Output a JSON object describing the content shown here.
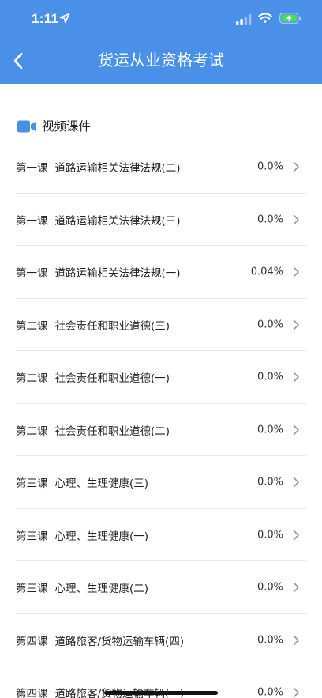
{
  "status_bar": {
    "time": "1:11"
  },
  "nav": {
    "title": "货运从业资格考试"
  },
  "section": {
    "title": "视频课件",
    "icon": "video-camera-icon"
  },
  "lessons": [
    {
      "number": "第一课",
      "name": "道路运输相关法律法规(二)",
      "progress": "0.0%"
    },
    {
      "number": "第一课",
      "name": "道路运输相关法律法规(三)",
      "progress": "0.0%"
    },
    {
      "number": "第一课",
      "name": "道路运输相关法律法规(一)",
      "progress": "0.04%"
    },
    {
      "number": "第二课",
      "name": "社会责任和职业道德(三)",
      "progress": "0.0%"
    },
    {
      "number": "第二课",
      "name": "社会责任和职业道德(一)",
      "progress": "0.0%"
    },
    {
      "number": "第二课",
      "name": "社会责任和职业道德(二)",
      "progress": "0.0%"
    },
    {
      "number": "第三课",
      "name": "心理、生理健康(三)",
      "progress": "0.0%"
    },
    {
      "number": "第三课",
      "name": "心理、生理健康(一)",
      "progress": "0.0%"
    },
    {
      "number": "第三课",
      "name": "心理、生理健康(二)",
      "progress": "0.0%"
    },
    {
      "number": "第四课",
      "name": "道路旅客/货物运输车辆(四)",
      "progress": "0.0%"
    },
    {
      "number": "第四课",
      "name": "道路旅客/货物运输车辆(一)",
      "progress": "0.0%"
    }
  ],
  "colors": {
    "header_bg": "#4a8fe8",
    "accent": "#4a8fe8"
  }
}
